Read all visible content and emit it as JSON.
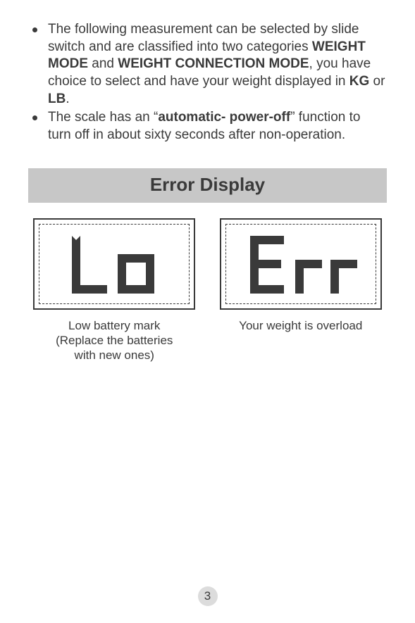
{
  "bullets": {
    "item1_pre": "The following measurement can be selected by slide switch and are classified into two categories ",
    "item1_b1": "WEIGHT MODE",
    "item1_mid1": " and ",
    "item1_b2": "WEIGHT CONNECTION MODE",
    "item1_mid2": ", you have choice to select and have your weight displayed in ",
    "item1_b3": "KG",
    "item1_mid3": " or ",
    "item1_b4": "LB",
    "item1_post": ".",
    "item2_pre": "The scale has an “",
    "item2_b1": "automatic- power-off",
    "item2_post": "” function to turn off in about sixty seconds after non-operation."
  },
  "section_header": "Error Display",
  "display1": {
    "value": "Lo",
    "caption_line1": "Low battery mark",
    "caption_line2": "(Replace the batteries",
    "caption_line3": "with new ones)"
  },
  "display2": {
    "value": "Err",
    "caption_line1": "Your weight is overload"
  },
  "page_number": "3"
}
